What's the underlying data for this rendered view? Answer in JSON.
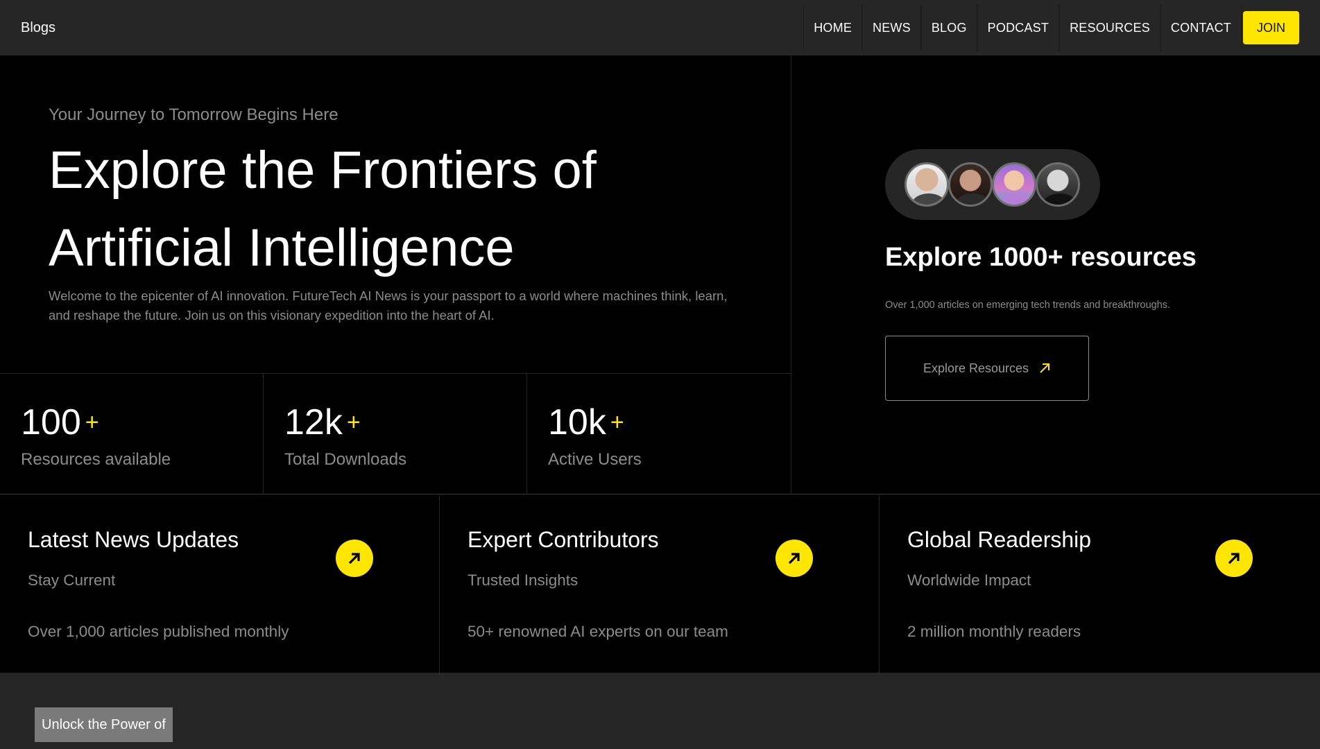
{
  "nav": {
    "brand": "Blogs",
    "links": [
      "HOME",
      "NEWS",
      "BLOG",
      "PODCAST",
      "RESOURCES",
      "CONTACT"
    ],
    "join_label": "JOIN"
  },
  "hero": {
    "tagline": "Your Journey to Tomorrow Begins Here",
    "title_line1": "Explore the Frontiers of",
    "title_line2": "Artificial Intelligence",
    "description": "Welcome to the epicenter of AI innovation. FutureTech AI News is your passport to a world where machines think, learn, and reshape the future. Join us on this visionary expedition into the heart of AI."
  },
  "stats": [
    {
      "value": "100",
      "plus": "+",
      "label": "Resources available"
    },
    {
      "value": "12k",
      "plus": "+",
      "label": "Total Downloads"
    },
    {
      "value": "10k",
      "plus": "+",
      "label": "Active Users"
    }
  ],
  "resources": {
    "title": "Explore 1000+ resources",
    "subtitle": "Over 1,000 articles on emerging tech trends and breakthroughs.",
    "button_label": "Explore Resources"
  },
  "features": [
    {
      "title": "Latest News Updates",
      "subtitle": "Stay Current",
      "description": "Over 1,000 articles published monthly"
    },
    {
      "title": "Expert Contributors",
      "subtitle": "Trusted Insights",
      "description": "50+ renowned AI experts on our team"
    },
    {
      "title": "Global Readership",
      "subtitle": "Worldwide Impact",
      "description": "2 million monthly readers"
    }
  ],
  "bottom": {
    "unlock_label": "Unlock the Power of"
  },
  "colors": {
    "accent": "#ffe600",
    "background": "#000000",
    "panel": "#262626",
    "muted_text": "#8c8c8c"
  },
  "icons": {
    "feature_arrow": "arrow-up-right-icon",
    "resources_arrow": "arrow-up-right-icon"
  }
}
